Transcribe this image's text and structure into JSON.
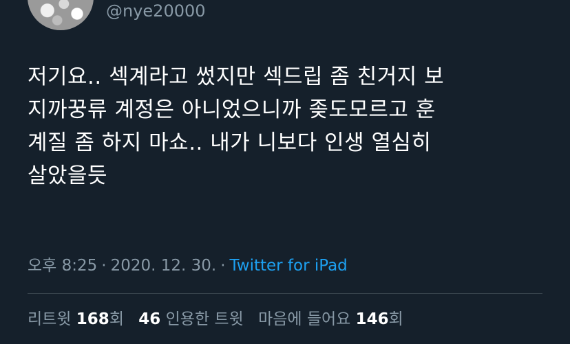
{
  "author": {
    "handle": "@nye20000"
  },
  "tweet": {
    "text": "저기요.. 섹계라고 썼지만 섹드립 좀 친거지 보\n지까꿍류 계정은 아니었으니까 좆도모르고 훈\n계질 좀 하지 마쇼.. 내가 니보다 인생 열심히\n살았을듯"
  },
  "meta": {
    "time": "오후 8:25",
    "separator": "·",
    "date": "2020. 12. 30.",
    "source": "Twitter for iPad"
  },
  "stats": {
    "retweets_label": "리트윗",
    "retweets_count": "168",
    "retweets_suffix": "회",
    "quotes_count": "46",
    "quotes_label": "인용한 트윗",
    "likes_label": "마음에 들어요",
    "likes_count": "146",
    "likes_suffix": "회"
  },
  "colors": {
    "background": "#15202b",
    "secondary_text": "#8899a6",
    "link": "#1da1f2",
    "divider": "#38444d"
  }
}
